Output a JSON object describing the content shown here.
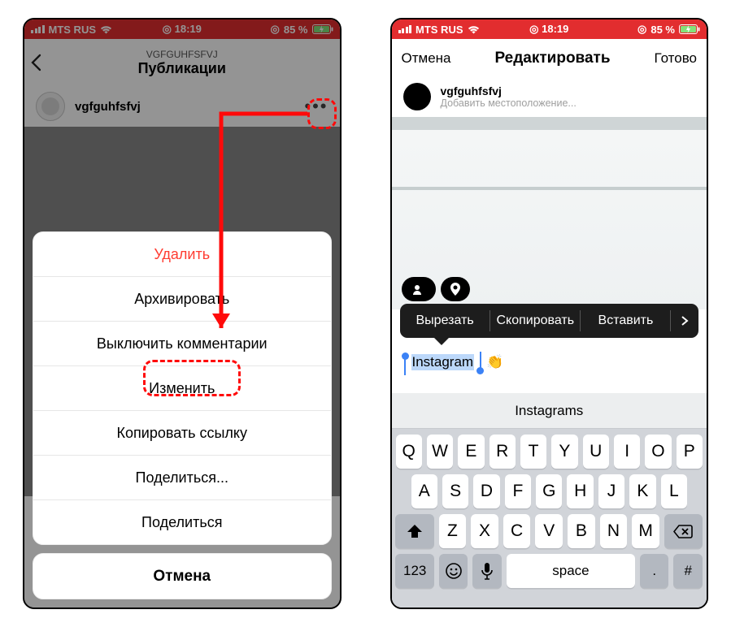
{
  "status": {
    "carrier": "MTS RUS",
    "time_prefix": "◎",
    "time": "18:19",
    "batt_prefix": "◎",
    "batt": "85 %"
  },
  "left": {
    "subtitle": "VGFGUHFSFVJ",
    "title": "Публикации",
    "post_user": "vgfguhfsfvj",
    "sheet": {
      "delete": "Удалить",
      "archive": "Архивировать",
      "mute": "Выключить комментарии",
      "edit": "Изменить",
      "copy": "Копировать ссылку",
      "share_ext": "Поделиться...",
      "share": "Поделиться",
      "cancel": "Отмена"
    }
  },
  "right": {
    "cancel": "Отмена",
    "title": "Редактировать",
    "done": "Готово",
    "user": "vgfguhfsfvj",
    "add_location": "Добавить местоположение...",
    "ctx": {
      "cut": "Вырезать",
      "copy": "Скопировать",
      "paste": "Вставить"
    },
    "caption_text": "Instagram",
    "caption_emoji": "👏",
    "suggestion": "Instagrams",
    "keys": {
      "row1": [
        "Q",
        "W",
        "E",
        "R",
        "T",
        "Y",
        "U",
        "I",
        "O",
        "P"
      ],
      "row2": [
        "A",
        "S",
        "D",
        "F",
        "G",
        "H",
        "J",
        "K",
        "L"
      ],
      "row3": [
        "Z",
        "X",
        "C",
        "V",
        "B",
        "N",
        "M"
      ],
      "num": "123",
      "space": "space",
      "punct1": ".",
      "punct2": "#"
    }
  }
}
